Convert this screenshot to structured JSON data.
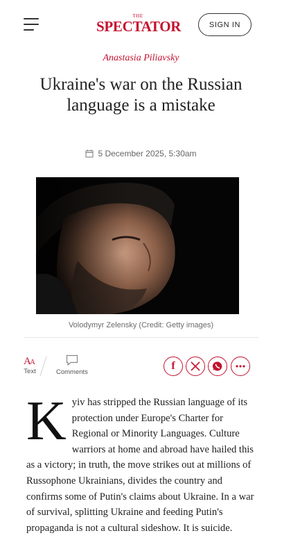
{
  "header": {
    "logo_the": "THE",
    "logo_main": "SPECTATOR",
    "signin_label": "SIGN IN",
    "brand_color": "#c4122f",
    "menu_icon": "hamburger-menu-icon"
  },
  "article": {
    "author": "Anastasia Piliavsky",
    "headline": "Ukraine's war on the Russian language is a mistake",
    "date": "5 December 2025, 5:30am",
    "caption": "Volodymyr Zelensky (Credit: Getty images)",
    "dropcap": "K",
    "body": "yiv has stripped the Russian language of its protection under Europe's Charter for Regional or Minority Languages. Culture warriors at home and abroad have hailed this as a victory; in truth, the move strikes out at millions of Russophone Ukrainians, divides the country and confirms some of Putin's claims about Ukraine. In a war of survival, splitting Ukraine and feeding Putin's propaganda is not a cultural sideshow. It is suicide."
  },
  "toolbar": {
    "text_label": "Text",
    "comments_label": "Comments",
    "text_icon": "text-size-icon",
    "comments_icon": "comment-bubble-icon"
  },
  "share": [
    {
      "name": "facebook-icon",
      "glyph": "f"
    },
    {
      "name": "x-icon",
      "glyph": "X"
    },
    {
      "name": "whatsapp-icon"
    },
    {
      "name": "more-icon",
      "glyph": "•••"
    }
  ]
}
